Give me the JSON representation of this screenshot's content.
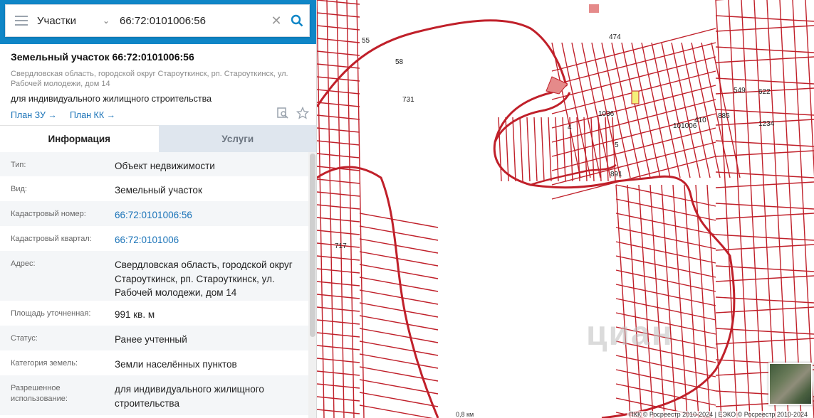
{
  "search": {
    "filter": "Участки",
    "query": "66:72:0101006:56"
  },
  "parcel": {
    "title": "Земельный участок 66:72:0101006:56",
    "address": "Свердловская область, городской округ Староуткинск, рп. Староуткинск, ул. Рабочей молодежи, дом 14",
    "permitted_use": "для индивидуального жилищного строительства",
    "link_plan_zu": "План ЗУ →",
    "link_plan_kk": "План КК →"
  },
  "tabs": {
    "info": "Информация",
    "services": "Услуги"
  },
  "rows": [
    {
      "label": "Тип:",
      "value": "Объект недвижимости",
      "link": false
    },
    {
      "label": "Вид:",
      "value": "Земельный участок",
      "link": false
    },
    {
      "label": "Кадастровый номер:",
      "value": "66:72:0101006:56",
      "link": true
    },
    {
      "label": "Кадастровый квартал:",
      "value": "66:72:0101006",
      "link": true
    },
    {
      "label": "Адрес:",
      "value": "Свердловская область, городской округ Староуткинск, рп. Староуткинск, ул. Рабочей молодежи, дом 14",
      "link": false
    },
    {
      "label": "Площадь уточненная:",
      "value": "991 кв. м",
      "link": false
    },
    {
      "label": "Статус:",
      "value": "Ранее учтенный",
      "link": false
    },
    {
      "label": "Категория земель:",
      "value": "Земли населённых пунктов",
      "link": false
    },
    {
      "label": "Разрешенное использование:",
      "value": "для индивидуального жилищного строительства",
      "link": false
    }
  ],
  "map": {
    "labels": [
      "474",
      "55",
      "58",
      "731",
      "1036",
      "4",
      "5",
      "891",
      "101006",
      "410",
      "885",
      "549",
      "622",
      "1234",
      "717"
    ],
    "scale": "0,8 км",
    "attribution": "ПКК © Росреестр 2010-2024 | ЕЭКО © Росреестр 2010-2024",
    "watermark": "циан"
  },
  "colors": {
    "accent": "#0f86c7",
    "link": "#1a73b8",
    "parcel_line": "#c0202a",
    "selected": "#f4f07a"
  },
  "icons": [
    "menu-icon",
    "chevron-down-icon",
    "close-icon",
    "search-icon",
    "chevron-left-icon",
    "arrow-right-icon",
    "search-doc-icon",
    "star-icon"
  ]
}
